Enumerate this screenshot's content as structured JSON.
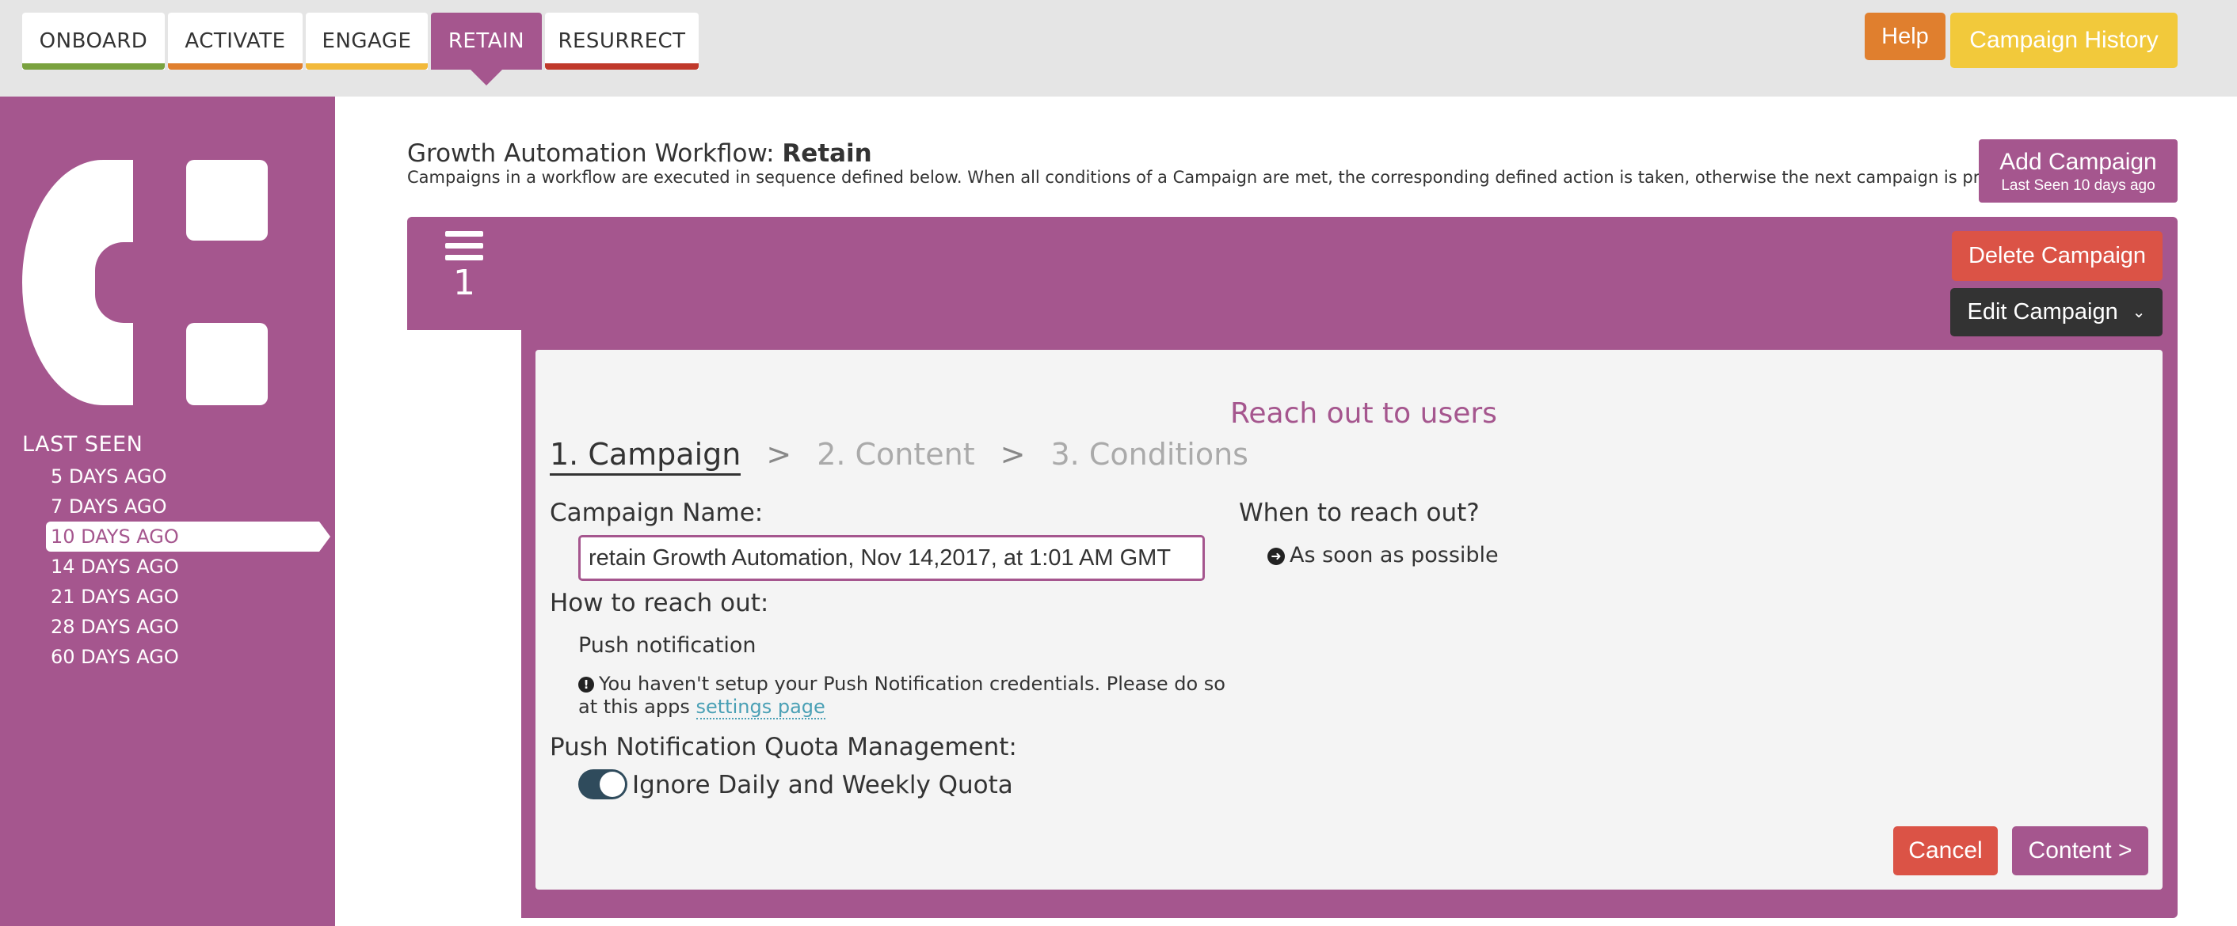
{
  "tabs": [
    {
      "label": "ONBOARD",
      "color": "#7aa23f"
    },
    {
      "label": "ACTIVATE",
      "color": "#e07f2e"
    },
    {
      "label": "ENGAGE",
      "color": "#f2b93b"
    },
    {
      "label": "RETAIN",
      "color": "#a5568e",
      "active": true
    },
    {
      "label": "RESURRECT",
      "color": "#c0392b"
    }
  ],
  "header": {
    "help_label": "Help",
    "history_label": "Campaign History"
  },
  "sidebar": {
    "title": "LAST SEEN",
    "items": [
      {
        "label": "5 DAYS AGO"
      },
      {
        "label": "7 DAYS AGO"
      },
      {
        "label": "10 DAYS AGO",
        "active": true
      },
      {
        "label": "14 DAYS AGO"
      },
      {
        "label": "21 DAYS AGO"
      },
      {
        "label": "28 DAYS AGO"
      },
      {
        "label": "60 DAYS AGO"
      }
    ]
  },
  "workflow": {
    "title_prefix": "Growth Automation Workflow:",
    "title_name": "Retain",
    "description": "Campaigns in a workflow are executed in sequence defined below. When all conditions of a Campaign are met, the corresponding defined action is taken, otherwise the next campaign is processed.",
    "add_label": "Add Campaign",
    "add_sub": "Last Seen 10 days ago"
  },
  "campaign": {
    "number": "1",
    "delete_label": "Delete Campaign",
    "edit_label": "Edit Campaign",
    "reach_title": "Reach out to users",
    "steps": [
      "1. Campaign",
      "2. Content",
      "3. Conditions"
    ],
    "step_separator": ">",
    "name_label": "Campaign Name:",
    "name_value": "retain Growth Automation, Nov 14,2017, at 1:01 AM GMT",
    "when_label": "When to reach out?",
    "when_value": "As soon as possible",
    "how_label": "How to reach out:",
    "how_value": "Push notification",
    "warning_text": "You haven't setup your Push Notification credentials. Please do so at this apps",
    "warning_link": "settings page",
    "quota_label": "Push Notification Quota Management:",
    "quota_toggle_label": "Ignore Daily and Weekly Quota",
    "quota_toggle_on": true,
    "cancel_label": "Cancel",
    "content_label": "Content >"
  },
  "colors": {
    "brand": "#a5568e",
    "danger": "#db5346",
    "help": "#e07f2e",
    "history": "#f2c93b",
    "dark": "#333333"
  }
}
